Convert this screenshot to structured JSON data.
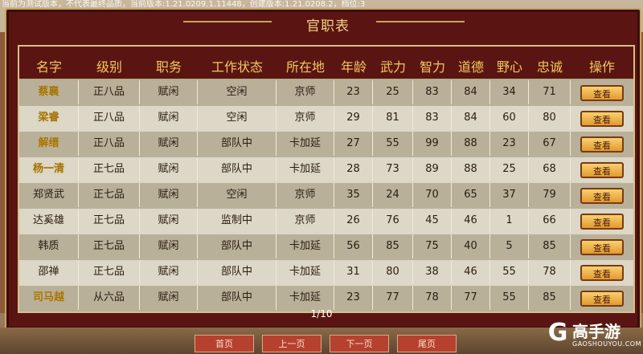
{
  "debug_text": "当前为测试版本，不代表最终品质，当前版本:1.21.0209.1.11448，创建版本:1.21.0208.2，档位:3",
  "panel": {
    "title": "官职表"
  },
  "table": {
    "headers": [
      "名字",
      "级别",
      "职务",
      "工作状态",
      "所在地",
      "年龄",
      "武力",
      "智力",
      "道德",
      "野心",
      "忠诚",
      "操作"
    ],
    "rows": [
      {
        "name": "蔡襄",
        "rank": "正八品",
        "duty": "赋闲",
        "status": "空闲",
        "location": "京师",
        "age": "23",
        "force": "25",
        "intellect": "83",
        "morality": "84",
        "ambition": "34",
        "loyalty": "71",
        "action": "查看"
      },
      {
        "name": "梁睿",
        "rank": "正八品",
        "duty": "赋闲",
        "status": "空闲",
        "location": "京师",
        "age": "29",
        "force": "81",
        "intellect": "83",
        "morality": "84",
        "ambition": "60",
        "loyalty": "80",
        "action": "查看"
      },
      {
        "name": "解缙",
        "rank": "正八品",
        "duty": "赋闲",
        "status": "部队中",
        "location": "卡加延",
        "age": "27",
        "force": "55",
        "intellect": "99",
        "morality": "88",
        "ambition": "23",
        "loyalty": "67",
        "action": "查看"
      },
      {
        "name": "杨一清",
        "rank": "正七品",
        "duty": "赋闲",
        "status": "部队中",
        "location": "卡加延",
        "age": "28",
        "force": "73",
        "intellect": "89",
        "morality": "88",
        "ambition": "25",
        "loyalty": "68",
        "action": "查看"
      },
      {
        "name": "郑贤武",
        "rank": "正七品",
        "duty": "赋闲",
        "status": "空闲",
        "location": "京师",
        "age": "35",
        "force": "24",
        "intellect": "70",
        "morality": "65",
        "ambition": "37",
        "loyalty": "79",
        "action": "查看"
      },
      {
        "name": "达奚雄",
        "rank": "正七品",
        "duty": "赋闲",
        "status": "监制中",
        "location": "京师",
        "age": "26",
        "force": "76",
        "intellect": "45",
        "morality": "46",
        "ambition": "1",
        "loyalty": "66",
        "action": "查看"
      },
      {
        "name": "韩质",
        "rank": "正七品",
        "duty": "赋闲",
        "status": "部队中",
        "location": "卡加延",
        "age": "56",
        "force": "85",
        "intellect": "75",
        "morality": "40",
        "ambition": "5",
        "loyalty": "85",
        "action": "查看"
      },
      {
        "name": "邵禅",
        "rank": "正七品",
        "duty": "赋闲",
        "status": "部队中",
        "location": "卡加延",
        "age": "31",
        "force": "80",
        "intellect": "38",
        "morality": "46",
        "ambition": "55",
        "loyalty": "78",
        "action": "查看"
      },
      {
        "name": "司马越",
        "rank": "从六品",
        "duty": "赋闲",
        "status": "部队中",
        "location": "卡加延",
        "age": "23",
        "force": "77",
        "intellect": "78",
        "morality": "77",
        "ambition": "55",
        "loyalty": "85",
        "action": "查看"
      }
    ]
  },
  "pagination": {
    "indicator": "1/10",
    "first": "首页",
    "prev": "上一页",
    "next": "下一页",
    "last": "尾页"
  },
  "watermark": {
    "logo": "G",
    "text": "高手游",
    "sub": "GAOSHOUYOU.COM"
  }
}
